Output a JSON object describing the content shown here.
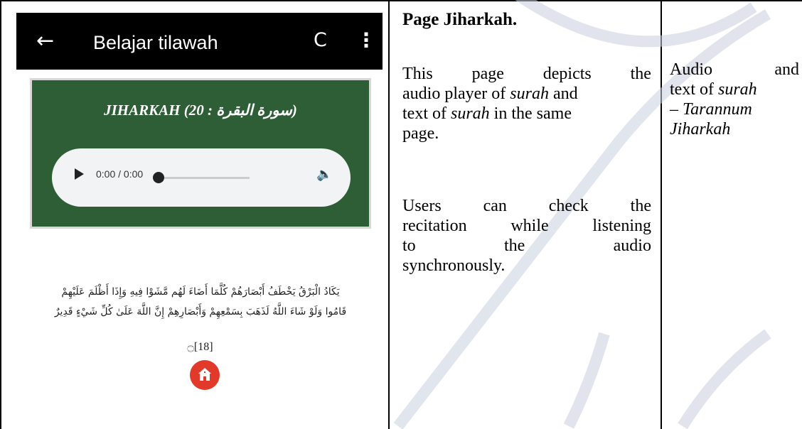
{
  "app": {
    "title": "Belajar tilawah",
    "back_icon": "arrow-left-icon",
    "refresh_icon": "refresh-icon",
    "more_icon": "more-vertical-icon"
  },
  "player": {
    "heading": "JIHARKAH (20 : سورة البقرة)",
    "time": "0:00 / 0:00",
    "card_color": "#2e5e35"
  },
  "verse": {
    "line1": "يَكَادُ الْبَرْقُ يَخْطَفُ أَبْصَارَهُمْ كُلَّمَا أَضَاءَ لَهُم مَّشَوْا فِيهِ وَإِذَا أَظْلَمَ عَلَيْهِمْ",
    "line2": "قَامُوا وَلَوْ شَاءَ اللَّهُ لَذَهَبَ بِسَمْعِهِمْ وَأَبْصَارِهِمْ إِنَّ اللَّهَ عَلَىٰ كُلِّ شَيْءٍ قَدِيرٌ",
    "number": "۝[18]"
  },
  "description": {
    "heading": "Page Jiharkah.",
    "p1_line1": [
      "This",
      "page",
      "depicts",
      "the"
    ],
    "p1_line2_a": "audio player of ",
    "p1_line2_b": "surah",
    "p1_line2_c": " and",
    "p1_line3_a": "text of ",
    "p1_line3_b": "surah",
    "p1_line3_c": " in the same",
    "p1_line4": "page.",
    "p2_line1": [
      "Users",
      "can",
      "check",
      "the"
    ],
    "p2_line2": [
      "recitation",
      "while",
      "listening"
    ],
    "p2_line3": [
      "to",
      "the",
      "audio"
    ],
    "p2_line4": "synchronously."
  },
  "remark": {
    "line1": [
      "Audio",
      "and"
    ],
    "line2_a": "text of ",
    "line2_b": "surah",
    "line3": "– Tarannum",
    "line4": "Jiharkah"
  }
}
